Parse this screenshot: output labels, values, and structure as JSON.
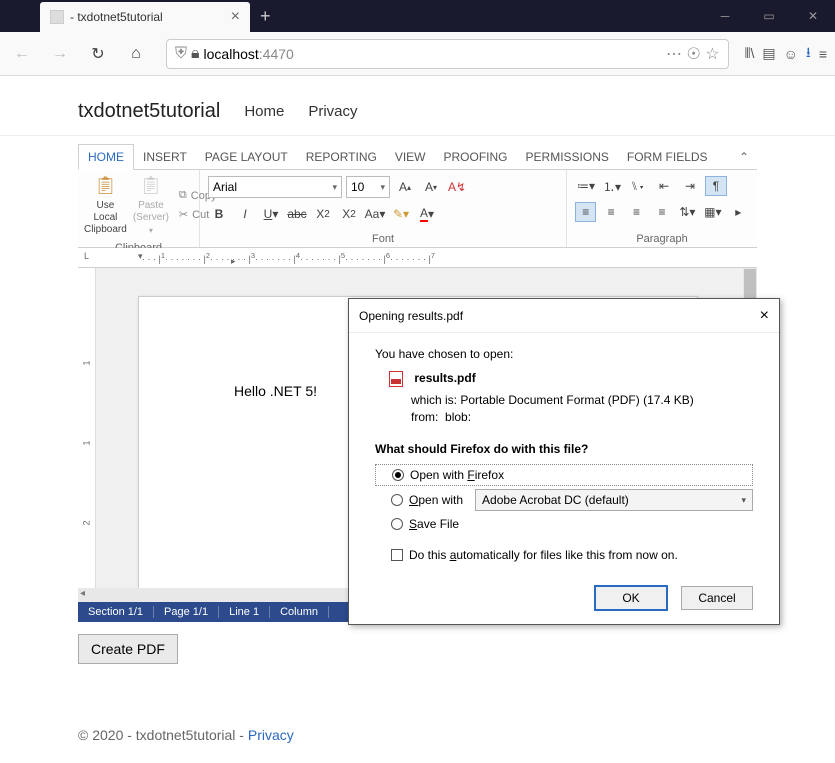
{
  "browser": {
    "tab_title": " - txdotnet5tutorial",
    "url_host": "localhost",
    "url_port": ":4470"
  },
  "nav": {
    "brand": "txdotnet5tutorial",
    "home": "Home",
    "privacy": "Privacy"
  },
  "ribbon_tabs": {
    "home": "HOME",
    "insert": "INSERT",
    "page_layout": "PAGE LAYOUT",
    "reporting": "REPORTING",
    "view": "VIEW",
    "proofing": "PROOFING",
    "permissions": "PERMISSIONS",
    "form_fields": "FORM FIELDS"
  },
  "ribbon": {
    "use_local_clipboard": "Use Local Clipboard",
    "paste": "Paste (Server)",
    "copy": "Copy",
    "cut": "Cut",
    "clipboard_label": "Clipboard",
    "font_name": "Arial",
    "font_size": "10",
    "font_label": "Font",
    "paragraph_label": "Paragraph"
  },
  "doc": {
    "body_text": "Hello .NET 5!"
  },
  "status": {
    "section": "Section 1/1",
    "page": "Page 1/1",
    "line": "Line 1",
    "column": "Column"
  },
  "create_pdf": "Create PDF",
  "footer": {
    "copyright": "© 2020 - txdotnet5tutorial - ",
    "privacy": "Privacy"
  },
  "dialog": {
    "title": "Opening results.pdf",
    "chosen": "You have chosen to open:",
    "filename": "results.pdf",
    "which_is_label": "which is:",
    "which_is": "Portable Document Format (PDF) (17.4 KB)",
    "from_label": "from:",
    "from": "blob:",
    "question": "What should Firefox do with this file?",
    "open_firefox": "Open with Firefox",
    "open_with": "Open with",
    "app": "Adobe Acrobat DC (default)",
    "save": "Save File",
    "auto": "Do this automatically for files like this from now on.",
    "ok": "OK",
    "cancel": "Cancel"
  }
}
